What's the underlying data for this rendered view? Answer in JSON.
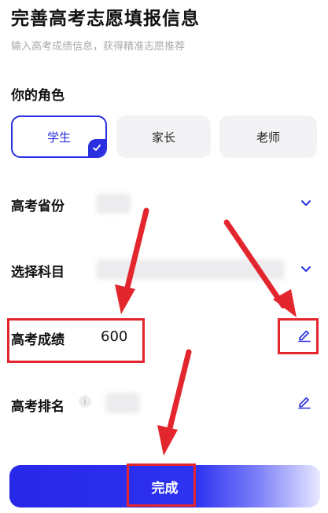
{
  "header": {
    "title": "完善高考志愿填报信息",
    "subtitle": "输入高考成绩信息，获得精准志愿推荐"
  },
  "role_section": {
    "label": "你的角色",
    "options": [
      "学生",
      "家长",
      "老师"
    ],
    "selected": "学生"
  },
  "form": {
    "province_label": "高考省份",
    "subjects_label": "选择科目",
    "score_label": "高考成绩",
    "score_value": "600",
    "rank_label": "高考排名",
    "rank_info": "i"
  },
  "submit_label": "完成",
  "colors": {
    "accent": "#2a2fe0",
    "annotation": "#e3262e"
  },
  "icons": [
    "check-icon",
    "chevron-down-icon",
    "edit-pencil-icon",
    "info-icon"
  ]
}
